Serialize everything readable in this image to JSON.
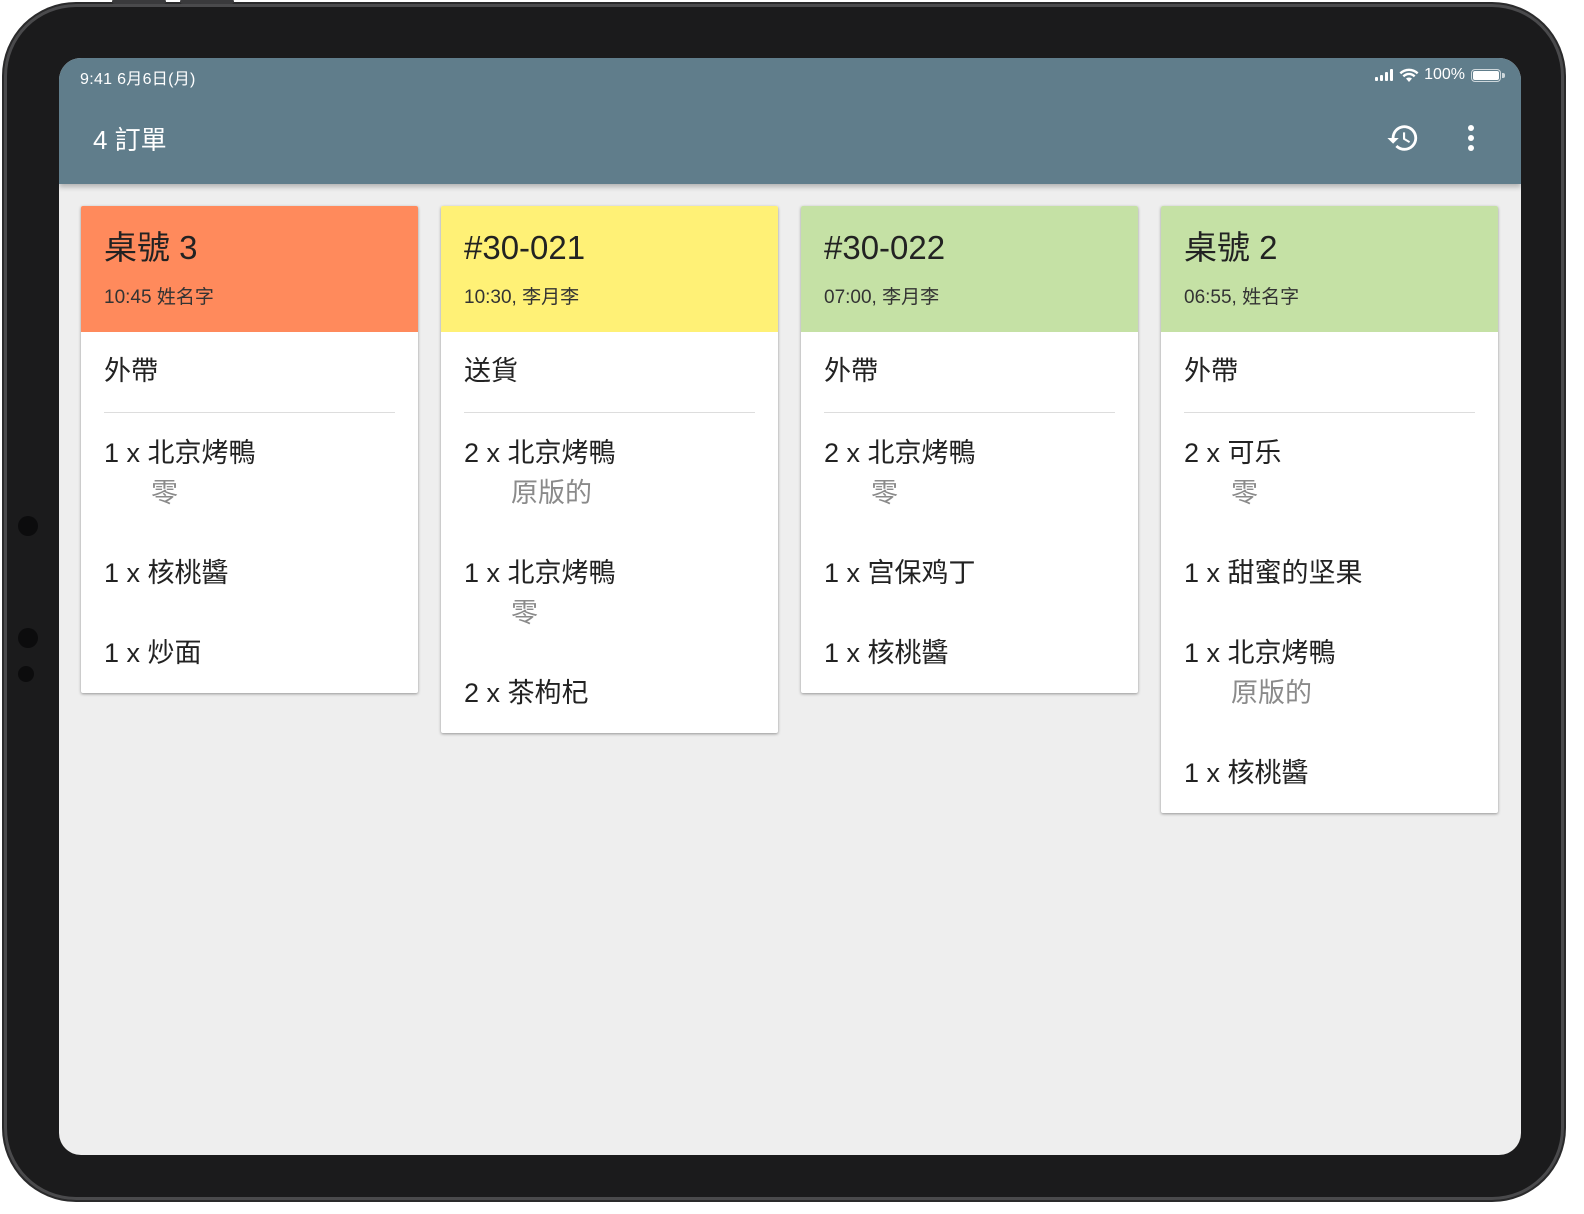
{
  "status_bar": {
    "time": "9:41  6月6日(月)",
    "battery": "100%"
  },
  "appbar": {
    "title": "4 訂單",
    "history_icon": "history-icon",
    "more_icon": "more-vert-icon",
    "color": "#607d8b"
  },
  "orders": [
    {
      "title": "桌號 3",
      "subtitle": "10:45  姓名字",
      "color": "#ff8a5c",
      "type": "外帶",
      "items": [
        {
          "line": "1 x 北京烤鴨",
          "modifier": "零"
        },
        {
          "line": "1 x 核桃醬",
          "modifier": ""
        },
        {
          "line": "1 x 炒面",
          "modifier": ""
        }
      ]
    },
    {
      "title": "#30-021",
      "subtitle": "10:30, 李月李",
      "color": "#fff176",
      "type": "送貨",
      "items": [
        {
          "line": "2 x 北京烤鴨",
          "modifier": "原版的"
        },
        {
          "line": "1 x 北京烤鴨",
          "modifier": "零"
        },
        {
          "line": "2 x 茶枸杞",
          "modifier": ""
        }
      ]
    },
    {
      "title": "#30-022",
      "subtitle": "07:00, 李月李",
      "color": "#c5e1a5",
      "type": "外帶",
      "items": [
        {
          "line": "2 x 北京烤鴨",
          "modifier": "零"
        },
        {
          "line": "1 x 宫保鸡丁",
          "modifier": ""
        },
        {
          "line": "1 x 核桃醬",
          "modifier": ""
        }
      ]
    },
    {
      "title": "桌號 2",
      "subtitle": "06:55, 姓名字",
      "color": "#c5e1a5",
      "type": "外帶",
      "items": [
        {
          "line": "2 x 可乐",
          "modifier": "零"
        },
        {
          "line": "1 x 甜蜜的坚果",
          "modifier": ""
        },
        {
          "line": "1 x 北京烤鴨",
          "modifier": "原版的"
        },
        {
          "line": "1 x 核桃醬",
          "modifier": ""
        }
      ]
    }
  ]
}
